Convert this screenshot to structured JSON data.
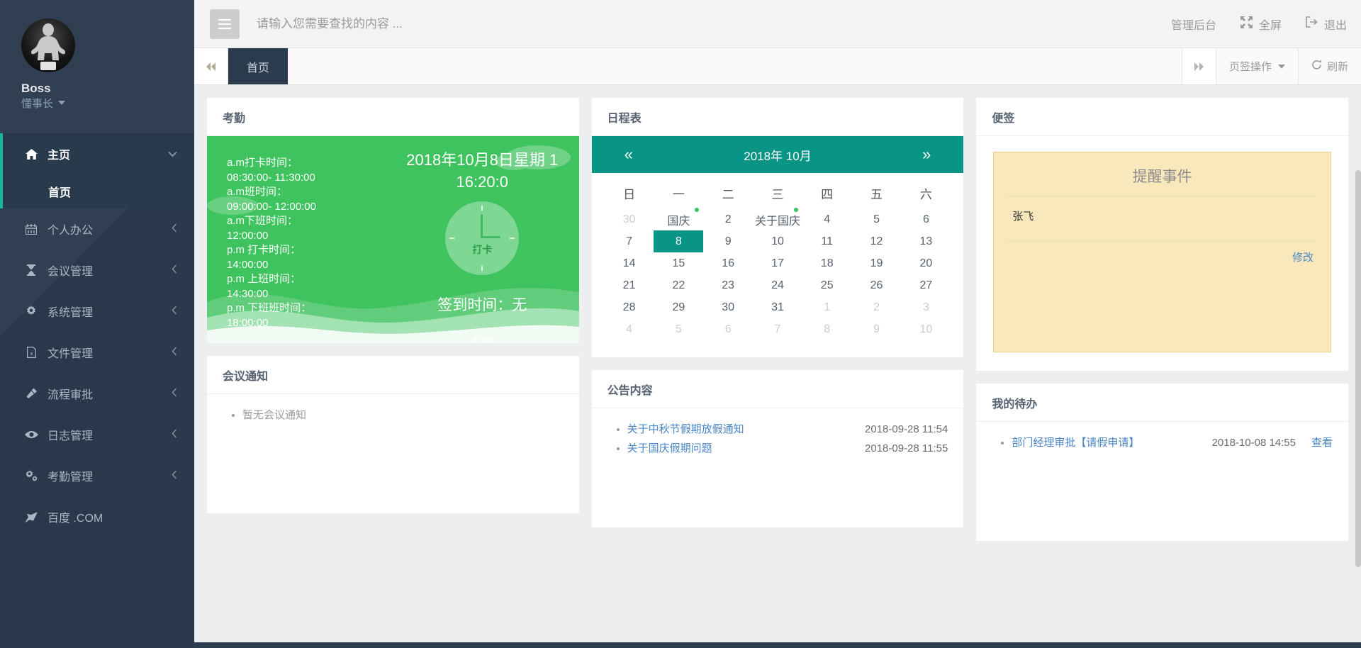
{
  "sidebar": {
    "profile": {
      "name": "Boss",
      "role": "懂事长",
      "avatar_icon": "user-avatar-photo"
    },
    "items": [
      {
        "label": "主页",
        "icon": "home-icon",
        "arrow": "chevron-down-icon",
        "active": true,
        "children": [
          {
            "label": "首页"
          }
        ]
      },
      {
        "label": "个人办公",
        "icon": "calendar-icon",
        "arrow": "chevron-left-icon"
      },
      {
        "label": "会议管理",
        "icon": "hourglass-icon",
        "arrow": "chevron-left-icon"
      },
      {
        "label": "系统管理",
        "icon": "gear-icon",
        "arrow": "chevron-left-icon"
      },
      {
        "label": "文件管理",
        "icon": "file-excel-icon",
        "arrow": "chevron-left-icon"
      },
      {
        "label": "流程审批",
        "icon": "gavel-icon",
        "arrow": "chevron-left-icon"
      },
      {
        "label": "日志管理",
        "icon": "eye-icon",
        "arrow": "chevron-left-icon"
      },
      {
        "label": "考勤管理",
        "icon": "cogs-icon",
        "arrow": "chevron-left-icon"
      },
      {
        "label": "百度 .COM",
        "icon": "paper-plane-icon",
        "arrow": ""
      }
    ]
  },
  "topbar": {
    "menu_toggle_icon": "hamburger-icon",
    "search_placeholder": "请输入您需要查找的内容 ...",
    "search_value": "",
    "actions": [
      {
        "label": "管理后台",
        "icon": ""
      },
      {
        "label": "全屏",
        "icon": "expand-icon"
      },
      {
        "label": "退出",
        "icon": "sign-out-icon"
      }
    ]
  },
  "tabbar": {
    "prev_icon": "double-chevron-left-icon",
    "next_icon": "double-chevron-right-icon",
    "tabs": [
      {
        "label": "首页",
        "active": true
      }
    ],
    "tools": [
      {
        "label": "页签操作",
        "icon": "caret-down-icon"
      },
      {
        "label": "刷新",
        "icon": "refresh-icon"
      }
    ]
  },
  "cards": {
    "attendance": {
      "title": "考勤",
      "datetime": "2018年10月8日星期 1",
      "time": "16:20:0",
      "clock_label": "打卡",
      "lines": [
        "a.m打卡时间：",
        "08:30:00- 11:30:00",
        "a.m班时间：",
        "09:00:00- 12:00:00",
        "a.m下班时间：",
        "12:00:00",
        "p.m 打卡时间：",
        "14:00:00",
        "p.m 上班时间：",
        "14:30:00",
        "p.m 下班班时间：",
        "18:00:00"
      ],
      "sign_time": "签到时间：无",
      "status": "未签"
    },
    "calendar": {
      "title": "日程表",
      "prev_icon": "double-chevron-left-icon",
      "next_icon": "double-chevron-right-icon",
      "header": "2018年  10月",
      "weekdays": [
        "日",
        "一",
        "二",
        "三",
        "四",
        "五",
        "六"
      ],
      "weeks": [
        [
          {
            "t": "30",
            "m": true
          },
          {
            "t": "国庆",
            "dot": true
          },
          {
            "t": "2"
          },
          {
            "t": "关于国庆",
            "dot": true
          },
          {
            "t": "4"
          },
          {
            "t": "5"
          },
          {
            "t": "6"
          }
        ],
        [
          {
            "t": "7"
          },
          {
            "t": "8",
            "sel": true
          },
          {
            "t": "9"
          },
          {
            "t": "10"
          },
          {
            "t": "11"
          },
          {
            "t": "12"
          },
          {
            "t": "13"
          }
        ],
        [
          {
            "t": "14"
          },
          {
            "t": "15"
          },
          {
            "t": "16"
          },
          {
            "t": "17"
          },
          {
            "t": "18"
          },
          {
            "t": "19"
          },
          {
            "t": "20"
          }
        ],
        [
          {
            "t": "21"
          },
          {
            "t": "22"
          },
          {
            "t": "23"
          },
          {
            "t": "24"
          },
          {
            "t": "25"
          },
          {
            "t": "26"
          },
          {
            "t": "27"
          }
        ],
        [
          {
            "t": "28"
          },
          {
            "t": "29"
          },
          {
            "t": "30"
          },
          {
            "t": "31"
          },
          {
            "t": "1",
            "m": true
          },
          {
            "t": "2",
            "m": true
          },
          {
            "t": "3",
            "m": true
          }
        ],
        [
          {
            "t": "4",
            "m": true
          },
          {
            "t": "5",
            "m": true
          },
          {
            "t": "6",
            "m": true
          },
          {
            "t": "7",
            "m": true
          },
          {
            "t": "8",
            "m": true
          },
          {
            "t": "9",
            "m": true
          },
          {
            "t": "10",
            "m": true
          }
        ]
      ]
    },
    "notes": {
      "title": "便签",
      "note_title": "提醒事件",
      "note_text": "张飞",
      "edit_label": "修改"
    },
    "meeting": {
      "title": "会议通知",
      "items": [
        {
          "text": "暂无会议通知",
          "link": false
        }
      ]
    },
    "announcement": {
      "title": "公告内容",
      "items": [
        {
          "text": "关于中秋节假期放假通知",
          "date": "2018-09-28 11:54"
        },
        {
          "text": "关于国庆假期问题",
          "date": "2018-09-28 11:55"
        }
      ]
    },
    "todo": {
      "title": "我的待办",
      "items": [
        {
          "text": "部门经理审批【请假申请】",
          "date": "2018-10-08 14:55",
          "action": "查看"
        }
      ]
    }
  },
  "colors": {
    "sidebar": "#2b3b4e",
    "accent_green": "#16b89a",
    "calendar_teal": "#089586",
    "attendance_green": "#3fc35e",
    "link_blue": "#4a86c8"
  }
}
